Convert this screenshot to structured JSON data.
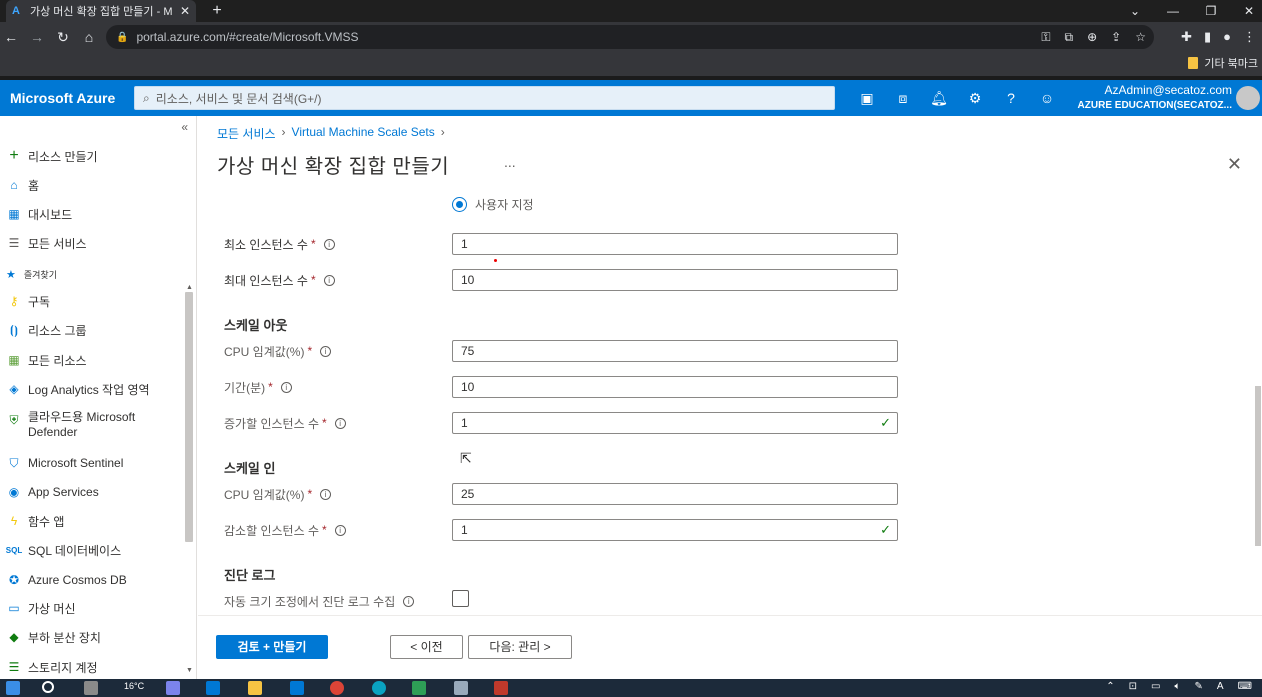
{
  "browser": {
    "tab_title": "가상 머신 확장 집합 만들기 - M",
    "url": "portal.azure.com/#create/Microsoft.VMSS",
    "bookmark_folder": "기타 북마크"
  },
  "azure_header": {
    "brand": "Microsoft Azure",
    "search_placeholder": "리소스, 서비스 및 문서 검색(G+/)",
    "user_email": "AzAdmin@secatoz.com",
    "user_tenant": "AZURE EDUCATION(SECATOZ..."
  },
  "sidenav": {
    "collapse": "«",
    "create": "리소스 만들기",
    "home": "홈",
    "dashboard": "대시보드",
    "all_services": "모든 서비스",
    "favorites": "즐겨찾기",
    "items": [
      {
        "label": "구독"
      },
      {
        "label": "리소스 그룹"
      },
      {
        "label": "모든 리소스"
      },
      {
        "label": "Log Analytics 작업 영역"
      },
      {
        "label": "클라우드용 Microsoft Defender"
      },
      {
        "label": "Microsoft Sentinel"
      },
      {
        "label": "App Services"
      },
      {
        "label": "함수 앱"
      },
      {
        "label": "SQL 데이터베이스"
      },
      {
        "label": "Azure Cosmos DB"
      },
      {
        "label": "가상 머신"
      },
      {
        "label": "부하 분산 장치"
      },
      {
        "label": "스토리지 계정"
      }
    ]
  },
  "breadcrumb": {
    "b1": "모든 서비스",
    "b2": "Virtual Machine Scale Sets"
  },
  "page": {
    "title": "가상 머신 확장 집합 만들기",
    "more": "...",
    "close": "✕"
  },
  "form": {
    "radio_label": "사용자 지정",
    "min_label": "최소 인스턴스 수",
    "min_value": "1",
    "max_label": "최대 인스턴스 수",
    "max_value": "10",
    "scale_out_title": "스케일 아웃",
    "out_cpu_label": "CPU 임계값(%)",
    "out_cpu_value": "75",
    "duration_label": "기간(분)",
    "duration_value": "10",
    "increase_label": "증가할 인스턴스 수",
    "increase_value": "1",
    "scale_in_title": "스케일 인",
    "in_cpu_label": "CPU 임계값(%)",
    "in_cpu_value": "25",
    "decrease_label": "감소할 인스턴스 수",
    "decrease_value": "1",
    "diag_title": "진단 로그",
    "diag_label": "자동 크기 조정에서 진단 로그 수집",
    "required": "*"
  },
  "footer": {
    "review": "검토 + 만들기",
    "prev": "< 이전",
    "next": "다음: 관리 >"
  },
  "taskbar": {
    "weather": "16°C"
  },
  "colors": {
    "azure_blue": "#0078d4",
    "valid_green": "#107c10",
    "required_red": "#a4262c"
  }
}
